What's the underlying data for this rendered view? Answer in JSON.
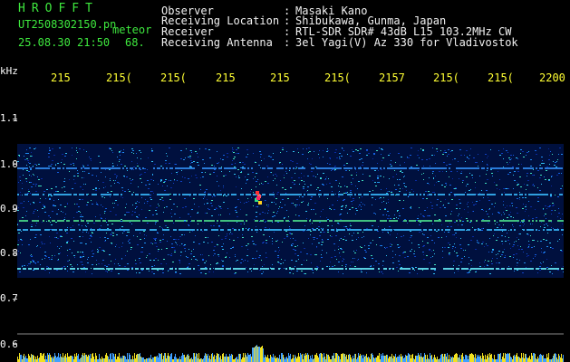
{
  "header": {
    "app_title": "HROFFT",
    "filename": "UT2508302150.pn",
    "meteor_label": "meteor",
    "datetime": "25.08.30 21:50",
    "count": "68."
  },
  "info": [
    {
      "label": "Observer",
      "value": "Masaki Kano"
    },
    {
      "label": "Receiving Location",
      "value": "Shibukawa, Gunma, Japan"
    },
    {
      "label": "Receiver",
      "value": "RTL-SDR SDR# 43dB L15 103.2MHz CW"
    },
    {
      "label": "Receiving Antenna",
      "value": "3el Yagi(V) Az 330 for Vladivostok"
    }
  ],
  "separator": ":",
  "y_axis": {
    "unit": "kHz",
    "ticks": [
      "1.1",
      "1.0",
      "0.9",
      "0.8",
      "0.7",
      "0.6"
    ]
  },
  "x_axis": {
    "ticks": [
      "215",
      "215(",
      "215(",
      "215",
      "215",
      "215(",
      "2157",
      "215(",
      "215(",
      "2200"
    ]
  },
  "colors": {
    "background": "#000000",
    "header_green": "#3ee83e",
    "header_white": "#f2f2f2",
    "time_labels": "#ffff33"
  }
}
